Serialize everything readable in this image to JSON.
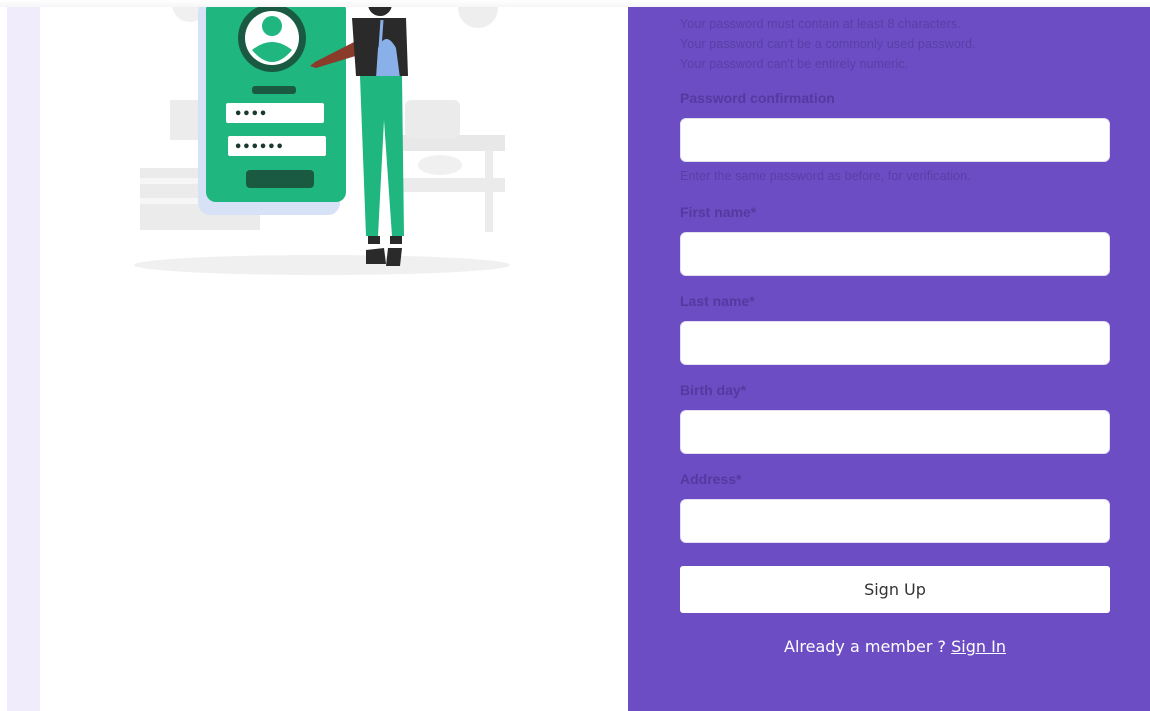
{
  "password_help": [
    "Your password must contain at least 8 characters.",
    "Your password can't be a commonly used password.",
    "Your password can't be entirely numeric."
  ],
  "fields": {
    "password_confirmation": {
      "label": "Password confirmation",
      "value": "",
      "help": "Enter the same password as before, for verification."
    },
    "first_name": {
      "label": "First name*",
      "value": ""
    },
    "last_name": {
      "label": "Last name*",
      "value": ""
    },
    "birth_day": {
      "label": "Birth day*",
      "value": ""
    },
    "address": {
      "label": "Address*",
      "value": ""
    }
  },
  "signup_button": "Sign Up",
  "footer": {
    "prompt": "Already a member ?",
    "signin_link": "Sign In"
  },
  "illustration": {
    "masked_pin": "••••",
    "masked_password": "••••••"
  },
  "colors": {
    "panel": "#6c4dc4",
    "accent_green": "#1fb67f",
    "lavender": "#f0ecfb"
  }
}
